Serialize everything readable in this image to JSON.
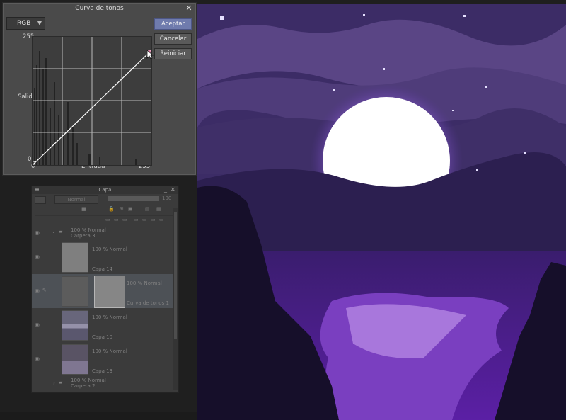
{
  "dialog": {
    "title": "Curva de tonos",
    "close_glyph": "✕",
    "channel": "RGB",
    "buttons": {
      "accept": "Aceptar",
      "cancel": "Cancelar",
      "reset": "Reiniciar"
    },
    "graph": {
      "y_max": "255",
      "y_min": "0",
      "y_label": "Salida",
      "x_min": "0",
      "x_max": "255",
      "x_label": "Entrada"
    }
  },
  "layers_panel": {
    "title": "Capa",
    "blend_mode": "Normal",
    "opacity": "100",
    "layers": [
      {
        "kind": "folder",
        "mode": "100 % Normal",
        "name": "Carpeta 3"
      },
      {
        "kind": "raster",
        "mode": "100 % Normal",
        "name": "Capa 14"
      },
      {
        "kind": "correction",
        "mode": "100 % Normal",
        "name": "Curva de tonos 1"
      },
      {
        "kind": "raster",
        "mode": "100 % Normal",
        "name": "Capa 10"
      },
      {
        "kind": "raster",
        "mode": "100 % Normal",
        "name": "Capa 13"
      },
      {
        "kind": "folder",
        "mode": "100 % Normal",
        "name": "Carpeta 2"
      }
    ]
  },
  "icons": [
    "close-icon",
    "chevron-down-icon",
    "eye-icon",
    "folder-icon",
    "pencil-icon",
    "cursor-icon"
  ],
  "colors": {
    "accent_button": "#6f7bad",
    "sky": "#3c2c66",
    "moon": "#ffffff",
    "water": "#8a3cc8"
  }
}
